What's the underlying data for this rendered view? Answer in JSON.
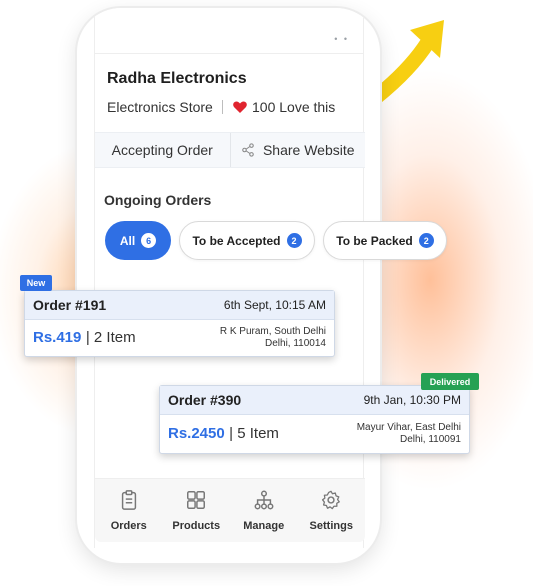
{
  "store": {
    "name": "Radha Electronics",
    "type": "Electronics Store",
    "love_text": "100 Love this"
  },
  "actions": {
    "accepting_order": "Accepting Order",
    "share_website": "Share Website"
  },
  "orders_section": {
    "title": "Ongoing Orders",
    "filters": [
      {
        "label": "All",
        "count": "6"
      },
      {
        "label": "To be Accepted",
        "count": "2"
      },
      {
        "label": "To be Packed",
        "count": "2"
      }
    ]
  },
  "orders": [
    {
      "badge": "New",
      "title": "Order #191",
      "time": "6th Sept, 10:15 AM",
      "price": "Rs.419",
      "items": "| 2 Item",
      "address_line1": "R K Puram, South Delhi",
      "address_line2": "Delhi, 110014"
    },
    {
      "badge": "Delivered",
      "title": "Order #390",
      "time": "9th Jan, 10:30 PM",
      "price": "Rs.2450",
      "items": "| 5 Item",
      "address_line1": "Mayur Vihar, East Delhi",
      "address_line2": "Delhi, 110091"
    }
  ],
  "nav": [
    {
      "label": "Orders",
      "icon": "clipboard-icon"
    },
    {
      "label": "Products",
      "icon": "grid-icon"
    },
    {
      "label": "Manage",
      "icon": "hierarchy-icon"
    },
    {
      "label": "Settings",
      "icon": "gear-icon"
    }
  ],
  "colors": {
    "accent": "#2f6fe4",
    "delivered": "#26a154",
    "heart": "#e0242f",
    "arrow": "#f7cf12"
  }
}
